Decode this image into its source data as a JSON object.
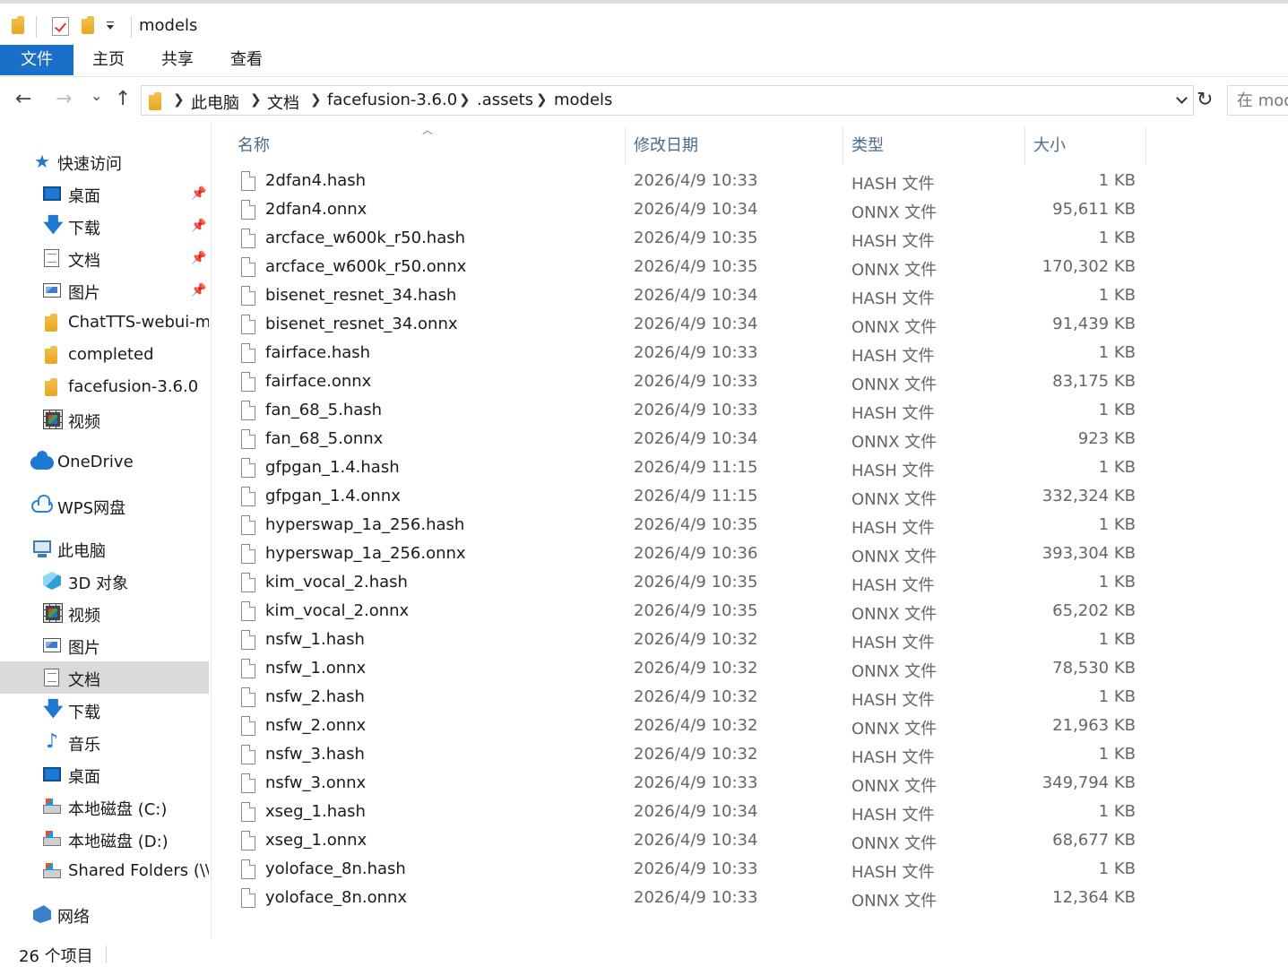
{
  "window": {
    "title": "models"
  },
  "ribbon": {
    "tabs": [
      "文件",
      "主页",
      "共享",
      "查看"
    ]
  },
  "nav": {
    "back": "←",
    "forward": "→",
    "recent": "⌄",
    "up": "↑",
    "breadcrumbs": [
      "此电脑",
      "文档",
      "facefusion-3.6.0",
      ".assets",
      "models"
    ],
    "refresh": "↻",
    "search_placeholder": "在 models 中搜索"
  },
  "sidebar": {
    "items": [
      {
        "label": "快速访问",
        "icon": "star-icon",
        "pinned": false,
        "selected": false
      },
      {
        "label": "桌面",
        "icon": "desktop-icon",
        "pinned": true,
        "selected": false
      },
      {
        "label": "下载",
        "icon": "download-icon",
        "pinned": true,
        "selected": false
      },
      {
        "label": "文档",
        "icon": "document-icon",
        "pinned": true,
        "selected": false
      },
      {
        "label": "图片",
        "icon": "picture-icon",
        "pinned": true,
        "selected": false
      },
      {
        "label": "ChatTTS-webui-m",
        "icon": "folder-icon",
        "pinned": false,
        "selected": false
      },
      {
        "label": "completed",
        "icon": "folder-icon",
        "pinned": false,
        "selected": false
      },
      {
        "label": "facefusion-3.6.0",
        "icon": "folder-icon",
        "pinned": false,
        "selected": false
      },
      {
        "label": "视频",
        "icon": "video-icon",
        "pinned": false,
        "selected": false
      },
      {
        "label": "OneDrive",
        "icon": "onedrive-cloud-icon",
        "pinned": false,
        "selected": false
      },
      {
        "label": "WPS网盘",
        "icon": "wps-cloud-icon",
        "pinned": false,
        "selected": false
      },
      {
        "label": "此电脑",
        "icon": "computer-icon",
        "pinned": false,
        "selected": false
      },
      {
        "label": "3D 对象",
        "icon": "3d-objects-icon",
        "pinned": false,
        "selected": false
      },
      {
        "label": "视频",
        "icon": "video-icon",
        "pinned": false,
        "selected": false
      },
      {
        "label": "图片",
        "icon": "picture-icon",
        "pinned": false,
        "selected": false
      },
      {
        "label": "文档",
        "icon": "document-icon",
        "pinned": false,
        "selected": true
      },
      {
        "label": "下载",
        "icon": "download-icon",
        "pinned": false,
        "selected": false
      },
      {
        "label": "音乐",
        "icon": "music-icon",
        "pinned": false,
        "selected": false
      },
      {
        "label": "桌面",
        "icon": "desktop-icon",
        "pinned": false,
        "selected": false
      },
      {
        "label": "本地磁盘 (C:)",
        "icon": "drive-icon",
        "pinned": false,
        "selected": false
      },
      {
        "label": "本地磁盘 (D:)",
        "icon": "drive-icon",
        "pinned": false,
        "selected": false
      },
      {
        "label": "Shared Folders (\\\\vmware-host)",
        "icon": "network-drive-icon",
        "pinned": false,
        "selected": false
      },
      {
        "label": "网络",
        "icon": "network-icon",
        "pinned": false,
        "selected": false
      }
    ]
  },
  "columns": {
    "name": "名称",
    "date": "修改日期",
    "type": "类型",
    "size": "大小"
  },
  "files": [
    {
      "name": "2dfan4.hash",
      "date": "2026/4/9 10:33",
      "type": "HASH 文件",
      "size": "1 KB"
    },
    {
      "name": "2dfan4.onnx",
      "date": "2026/4/9 10:34",
      "type": "ONNX 文件",
      "size": "95,611 KB"
    },
    {
      "name": "arcface_w600k_r50.hash",
      "date": "2026/4/9 10:35",
      "type": "HASH 文件",
      "size": "1 KB"
    },
    {
      "name": "arcface_w600k_r50.onnx",
      "date": "2026/4/9 10:35",
      "type": "ONNX 文件",
      "size": "170,302 KB"
    },
    {
      "name": "bisenet_resnet_34.hash",
      "date": "2026/4/9 10:34",
      "type": "HASH 文件",
      "size": "1 KB"
    },
    {
      "name": "bisenet_resnet_34.onnx",
      "date": "2026/4/9 10:34",
      "type": "ONNX 文件",
      "size": "91,439 KB"
    },
    {
      "name": "fairface.hash",
      "date": "2026/4/9 10:33",
      "type": "HASH 文件",
      "size": "1 KB"
    },
    {
      "name": "fairface.onnx",
      "date": "2026/4/9 10:33",
      "type": "ONNX 文件",
      "size": "83,175 KB"
    },
    {
      "name": "fan_68_5.hash",
      "date": "2026/4/9 10:33",
      "type": "HASH 文件",
      "size": "1 KB"
    },
    {
      "name": "fan_68_5.onnx",
      "date": "2026/4/9 10:34",
      "type": "ONNX 文件",
      "size": "923 KB"
    },
    {
      "name": "gfpgan_1.4.hash",
      "date": "2026/4/9 11:15",
      "type": "HASH 文件",
      "size": "1 KB"
    },
    {
      "name": "gfpgan_1.4.onnx",
      "date": "2026/4/9 11:15",
      "type": "ONNX 文件",
      "size": "332,324 KB"
    },
    {
      "name": "hyperswap_1a_256.hash",
      "date": "2026/4/9 10:35",
      "type": "HASH 文件",
      "size": "1 KB"
    },
    {
      "name": "hyperswap_1a_256.onnx",
      "date": "2026/4/9 10:36",
      "type": "ONNX 文件",
      "size": "393,304 KB"
    },
    {
      "name": "kim_vocal_2.hash",
      "date": "2026/4/9 10:35",
      "type": "HASH 文件",
      "size": "1 KB"
    },
    {
      "name": "kim_vocal_2.onnx",
      "date": "2026/4/9 10:35",
      "type": "ONNX 文件",
      "size": "65,202 KB"
    },
    {
      "name": "nsfw_1.hash",
      "date": "2026/4/9 10:32",
      "type": "HASH 文件",
      "size": "1 KB"
    },
    {
      "name": "nsfw_1.onnx",
      "date": "2026/4/9 10:32",
      "type": "ONNX 文件",
      "size": "78,530 KB"
    },
    {
      "name": "nsfw_2.hash",
      "date": "2026/4/9 10:32",
      "type": "HASH 文件",
      "size": "1 KB"
    },
    {
      "name": "nsfw_2.onnx",
      "date": "2026/4/9 10:32",
      "type": "ONNX 文件",
      "size": "21,963 KB"
    },
    {
      "name": "nsfw_3.hash",
      "date": "2026/4/9 10:32",
      "type": "HASH 文件",
      "size": "1 KB"
    },
    {
      "name": "nsfw_3.onnx",
      "date": "2026/4/9 10:33",
      "type": "ONNX 文件",
      "size": "349,794 KB"
    },
    {
      "name": "xseg_1.hash",
      "date": "2026/4/9 10:34",
      "type": "HASH 文件",
      "size": "1 KB"
    },
    {
      "name": "xseg_1.onnx",
      "date": "2026/4/9 10:34",
      "type": "ONNX 文件",
      "size": "68,677 KB"
    },
    {
      "name": "yoloface_8n.hash",
      "date": "2026/4/9 10:33",
      "type": "HASH 文件",
      "size": "1 KB"
    },
    {
      "name": "yoloface_8n.onnx",
      "date": "2026/4/9 10:33",
      "type": "ONNX 文件",
      "size": "12,364 KB"
    }
  ],
  "status": {
    "item_count": "26 个项目"
  },
  "colors": {
    "accent": "#1a6fc9",
    "selected_bg": "#d9d9d9",
    "header_text": "#4d6b8a"
  }
}
